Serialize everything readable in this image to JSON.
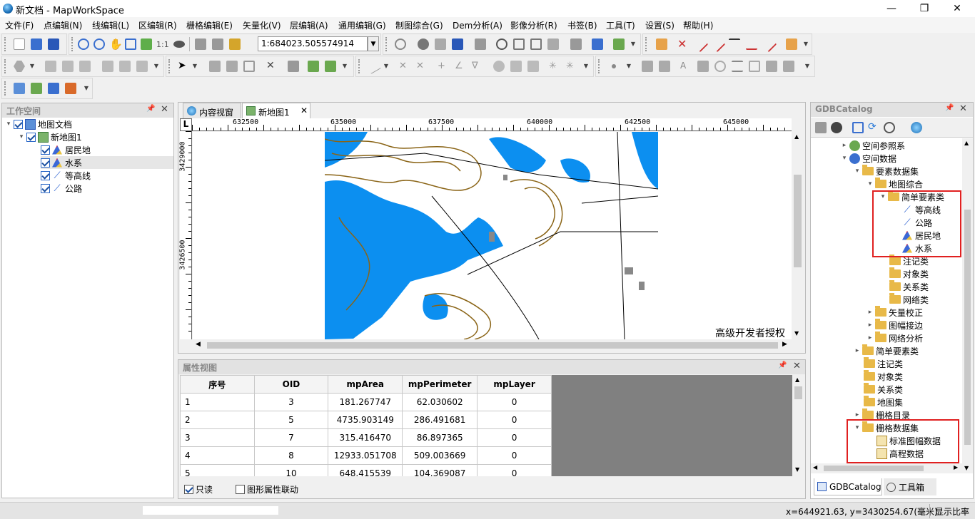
{
  "window": {
    "title": "新文档 - MapWorkSpace",
    "controls": [
      "—",
      "❐",
      "✕"
    ]
  },
  "menu": [
    "文件(F)",
    "点编辑(N)",
    "线编辑(L)",
    "区编辑(R)",
    "栅格编辑(E)",
    "矢量化(V)",
    "层编辑(A)",
    "通用编辑(G)",
    "制图综合(G)",
    "Dem分析(A)",
    "影像分析(R)",
    "书签(B)",
    "工具(T)",
    "设置(S)",
    "帮助(H)"
  ],
  "toolbar": {
    "ratio": "1:1",
    "scale": "1:684023.505574914"
  },
  "workspace": {
    "title": "工作空间",
    "items": [
      {
        "label": "地图文档",
        "type": "doc"
      },
      {
        "label": "新地图1",
        "type": "map"
      },
      {
        "label": "居民地",
        "type": "poly"
      },
      {
        "label": "水系",
        "type": "poly"
      },
      {
        "label": "等高线",
        "type": "line"
      },
      {
        "label": "公路",
        "type": "line"
      }
    ]
  },
  "tabs": [
    {
      "label": "内容视窗"
    },
    {
      "label": "新地图1"
    }
  ],
  "map": {
    "ruler_corner": "L",
    "x_ticks": [
      "632500",
      "635000",
      "637500",
      "640000",
      "642500",
      "645000"
    ],
    "y_ticks": [
      "3429000",
      "3426500"
    ],
    "watermark": "高级开发者授权",
    "colors": {
      "water": "#0c8ff0",
      "contour": "#8a6416",
      "road": "#000000",
      "settlement": "#888888"
    }
  },
  "attribute_view": {
    "title": "属性视图",
    "columns": [
      "序号",
      "OID",
      "mpArea",
      "mpPerimeter",
      "mpLayer"
    ],
    "rows": [
      [
        "1",
        "3",
        "181.267747",
        "62.030602",
        "0"
      ],
      [
        "2",
        "5",
        "4735.903149",
        "286.491681",
        "0"
      ],
      [
        "3",
        "7",
        "315.416470",
        "86.897365",
        "0"
      ],
      [
        "4",
        "8",
        "12933.051708",
        "509.003669",
        "0"
      ],
      [
        "5",
        "10",
        "648.415539",
        "104.369087",
        "0"
      ]
    ],
    "readonly_label": "只读",
    "link_label": "图形属性联动"
  },
  "catalog": {
    "title": "GDBCatalog",
    "items": [
      {
        "label": "空间参照系"
      },
      {
        "label": "空间数据"
      },
      {
        "label": "要素数据集"
      },
      {
        "label": "地图综合"
      },
      {
        "label": "简单要素类"
      },
      {
        "label": "等高线"
      },
      {
        "label": "公路"
      },
      {
        "label": "居民地"
      },
      {
        "label": "水系"
      },
      {
        "label": "注记类"
      },
      {
        "label": "对象类"
      },
      {
        "label": "关系类"
      },
      {
        "label": "网络类"
      },
      {
        "label": "矢量校正"
      },
      {
        "label": "图幅接边"
      },
      {
        "label": "网络分析"
      },
      {
        "label": "简单要素类"
      },
      {
        "label": "注记类"
      },
      {
        "label": "对象类"
      },
      {
        "label": "关系类"
      },
      {
        "label": "地图集"
      },
      {
        "label": "栅格目录"
      },
      {
        "label": "栅格数据集"
      },
      {
        "label": "标准图幅数据"
      },
      {
        "label": "高程数据"
      }
    ],
    "bottom_tabs": [
      "GDBCatalog",
      "工具箱"
    ]
  },
  "statusbar": {
    "coords": "x=644921.63, y=3430254.67(毫米)",
    "right": "显示比率"
  }
}
